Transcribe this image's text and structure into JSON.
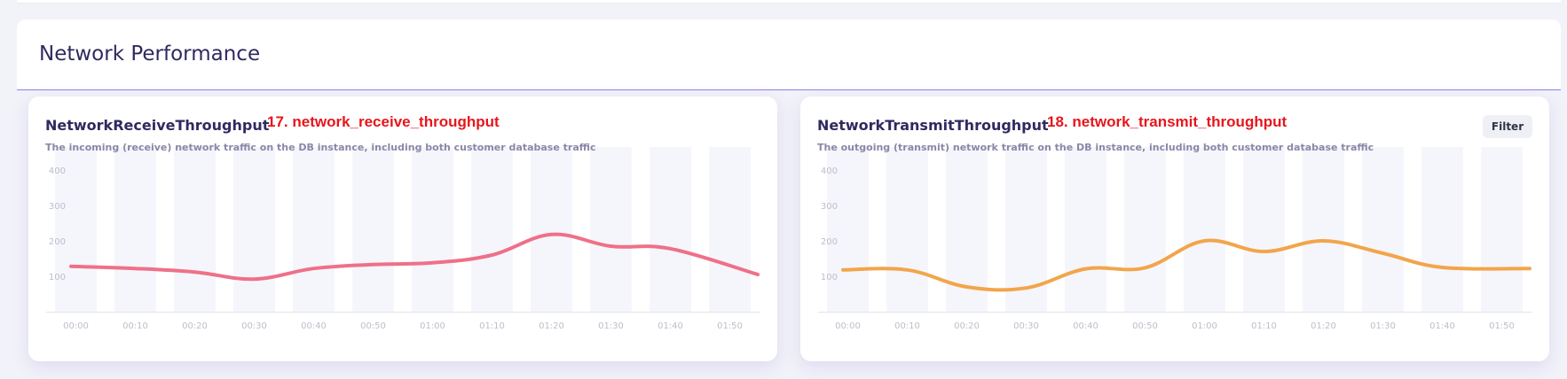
{
  "section": {
    "title": "Network Performance"
  },
  "cards": [
    {
      "title": "NetworkReceiveThroughput",
      "annotation": "17. network_receive_throughput",
      "description": "The incoming (receive) network traffic on the DB instance, including both customer database traffic"
    },
    {
      "title": "NetworkTransmitThroughput",
      "annotation": "18. network_transmit_throughput",
      "description": "The outgoing (transmit) network traffic on the DB instance, including both customer database traffic",
      "filter_label": "Filter"
    }
  ],
  "chart_data": [
    {
      "type": "line",
      "x": [
        "00:00",
        "00:10",
        "00:20",
        "00:30",
        "00:40",
        "00:50",
        "01:00",
        "01:10",
        "01:20",
        "01:30",
        "01:40",
        "01:50"
      ],
      "ylim": [
        0,
        400
      ],
      "yticks": [
        100,
        200,
        300,
        400
      ],
      "grid": "alternating vertical bands",
      "series": [
        {
          "color": "#ef7088",
          "values": [
            128,
            122,
            112,
            92,
            122,
            133,
            138,
            160,
            218,
            185,
            178,
            105
          ]
        }
      ]
    },
    {
      "type": "line",
      "x": [
        "00:00",
        "00:10",
        "00:20",
        "00:30",
        "00:40",
        "00:50",
        "01:00",
        "01:10",
        "01:20",
        "01:30",
        "01:40",
        "01:50"
      ],
      "ylim": [
        0,
        400
      ],
      "yticks": [
        100,
        200,
        300,
        400
      ],
      "grid": "alternating vertical bands",
      "series": [
        {
          "color": "#f2a54a",
          "values": [
            118,
            118,
            70,
            67,
            121,
            124,
            200,
            170,
            200,
            165,
            125,
            122
          ]
        }
      ]
    }
  ]
}
